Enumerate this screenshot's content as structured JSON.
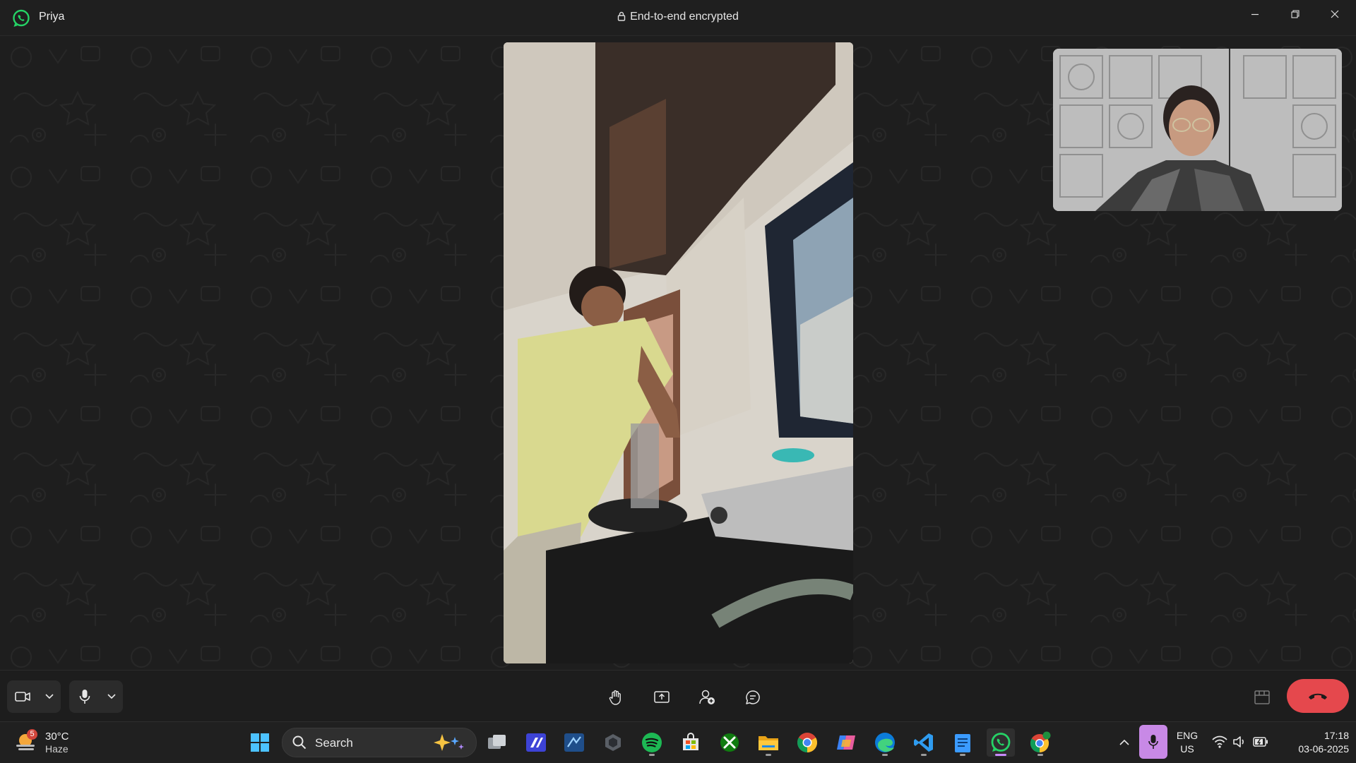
{
  "titlebar": {
    "contact_name": "Priya",
    "encryption_status": "End-to-end encrypted",
    "icons": [
      "whatsapp-icon",
      "lock-icon",
      "minimize-icon",
      "restore-icon",
      "close-icon"
    ]
  },
  "call": {
    "main_video": "remote-participant-video",
    "self_view": "local-camera-preview",
    "controls": {
      "camera": "video-camera-icon",
      "microphone": "microphone-icon",
      "center_buttons": [
        "raise-hand-icon",
        "share-screen-icon",
        "add-participant-icon",
        "chat-icon"
      ],
      "layout": "layout-icon",
      "end_call": "end-call-icon"
    },
    "colors": {
      "end_call": "#e5484d",
      "accent": "#25d366"
    }
  },
  "taskbar": {
    "weather": {
      "temp": "30°C",
      "condition": "Haze",
      "badge": "5"
    },
    "search_label": "Search",
    "pinned_apps": [
      "windows-start",
      "task-view",
      "powerapps",
      "remote-desktop",
      "unity",
      "spotify",
      "microsoft-store",
      "xbox",
      "file-explorer",
      "chrome",
      "copilot",
      "edge",
      "vscode",
      "notepad",
      "whatsapp",
      "chrome-profile"
    ],
    "language_line1": "ENG",
    "language_line2": "US",
    "time": "17:18",
    "date": "03-06-2025"
  }
}
